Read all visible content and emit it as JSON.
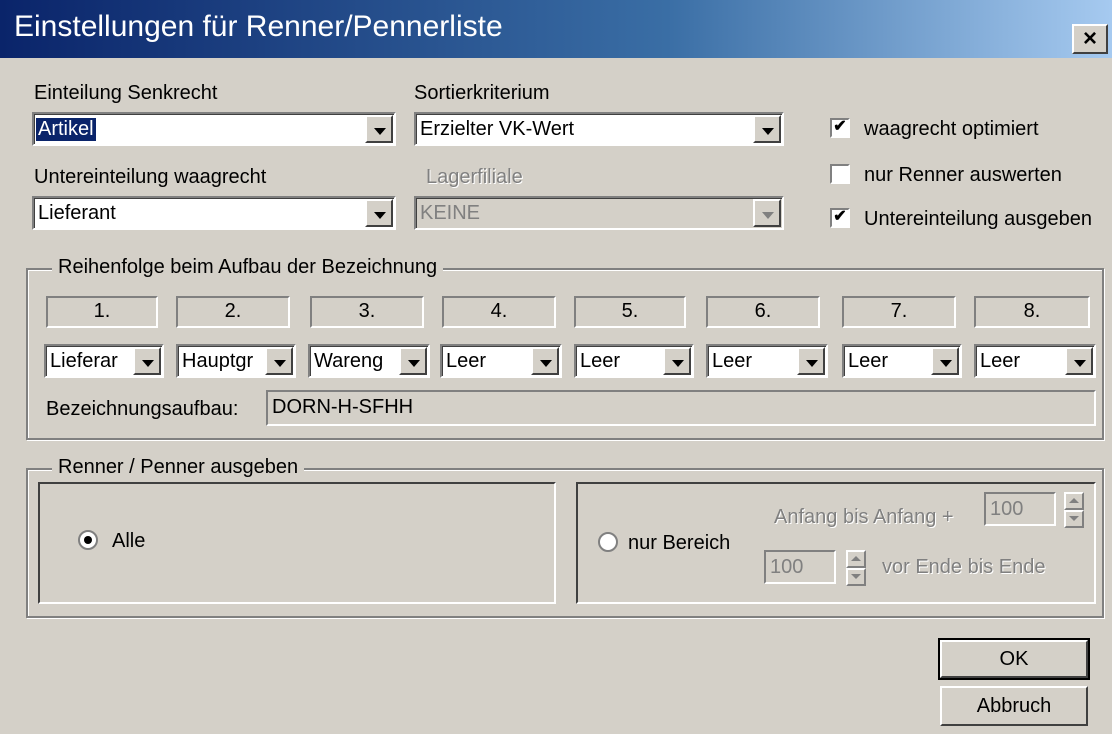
{
  "window": {
    "title": "Einstellungen für Renner/Pennerliste",
    "close_label": "×"
  },
  "senkrecht": {
    "label": "Einteilung Senkrecht",
    "value": "Artikel"
  },
  "sortier": {
    "label": "Sortierkriterium",
    "value": "Erzielter VK-Wert"
  },
  "waagrecht": {
    "label": "Untereinteilung waagrecht",
    "value": "Lieferant"
  },
  "lager": {
    "label": "Lagerfiliale",
    "value": "KEINE"
  },
  "options": [
    {
      "label": "waagrecht optimiert",
      "checked": true,
      "mark": "✔"
    },
    {
      "label": "nur Renner auswerten",
      "checked": false,
      "mark": ""
    },
    {
      "label": "Untereinteilung ausgeben",
      "checked": true,
      "mark": "✔"
    }
  ],
  "reihenfolge": {
    "legend": "Reihenfolge beim Aufbau der Bezeichnung",
    "columns": [
      {
        "num": "1.",
        "value": "Lieferar"
      },
      {
        "num": "2.",
        "value": "Hauptgr"
      },
      {
        "num": "3.",
        "value": "Wareng"
      },
      {
        "num": "4.",
        "value": "Leer"
      },
      {
        "num": "5.",
        "value": "Leer"
      },
      {
        "num": "6.",
        "value": "Leer"
      },
      {
        "num": "7.",
        "value": "Leer"
      },
      {
        "num": "8.",
        "value": "Leer"
      }
    ],
    "aufbau_label": "Bezeichnungsaufbau:",
    "aufbau_value": "DORN-H-SFHH"
  },
  "ausgeben": {
    "legend": "Renner / Penner ausgeben",
    "alle": "Alle",
    "bereich": "nur Bereich",
    "anfang_label": "Anfang bis Anfang +",
    "anfang_value": "100",
    "ende_value": "100",
    "ende_label": "vor Ende bis Ende"
  },
  "buttons": {
    "ok": "OK",
    "cancel": "Abbruch"
  }
}
